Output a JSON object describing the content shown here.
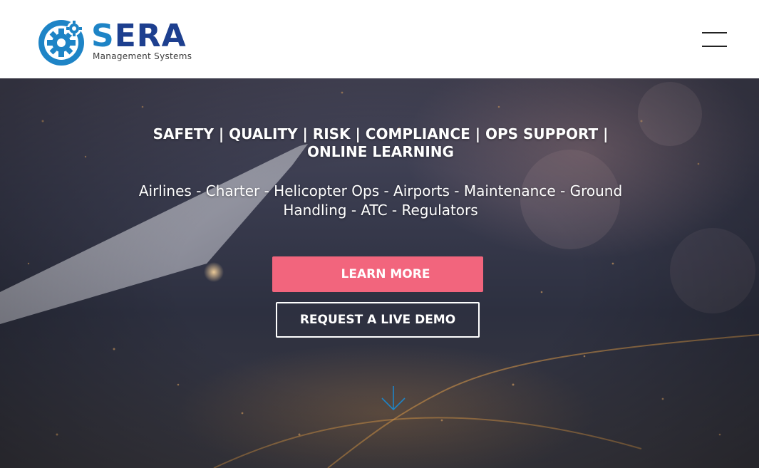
{
  "header": {
    "logo": {
      "wordmark_s": "S",
      "wordmark_rest": "ERA",
      "subtitle": "Management Systems",
      "colors": {
        "primary": "#1e84c6",
        "dark": "#1d3f8f"
      }
    },
    "menu_icon": "hamburger-menu-icon"
  },
  "hero": {
    "tagline": "SAFETY | QUALITY | RISK | COMPLIANCE | OPS SUPPORT | ONLINE LEARNING",
    "segments": "Airlines - Charter - Helicopter Ops - Airports - Maintenance - Ground Handling - ATC - Regulators",
    "learn_more_label": "LEARN MORE",
    "request_demo_label": "REQUEST A LIVE DEMO",
    "scroll_icon": "arrow-down-icon",
    "colors": {
      "accent": "#f2657d",
      "arrow": "#1e84c6"
    }
  }
}
